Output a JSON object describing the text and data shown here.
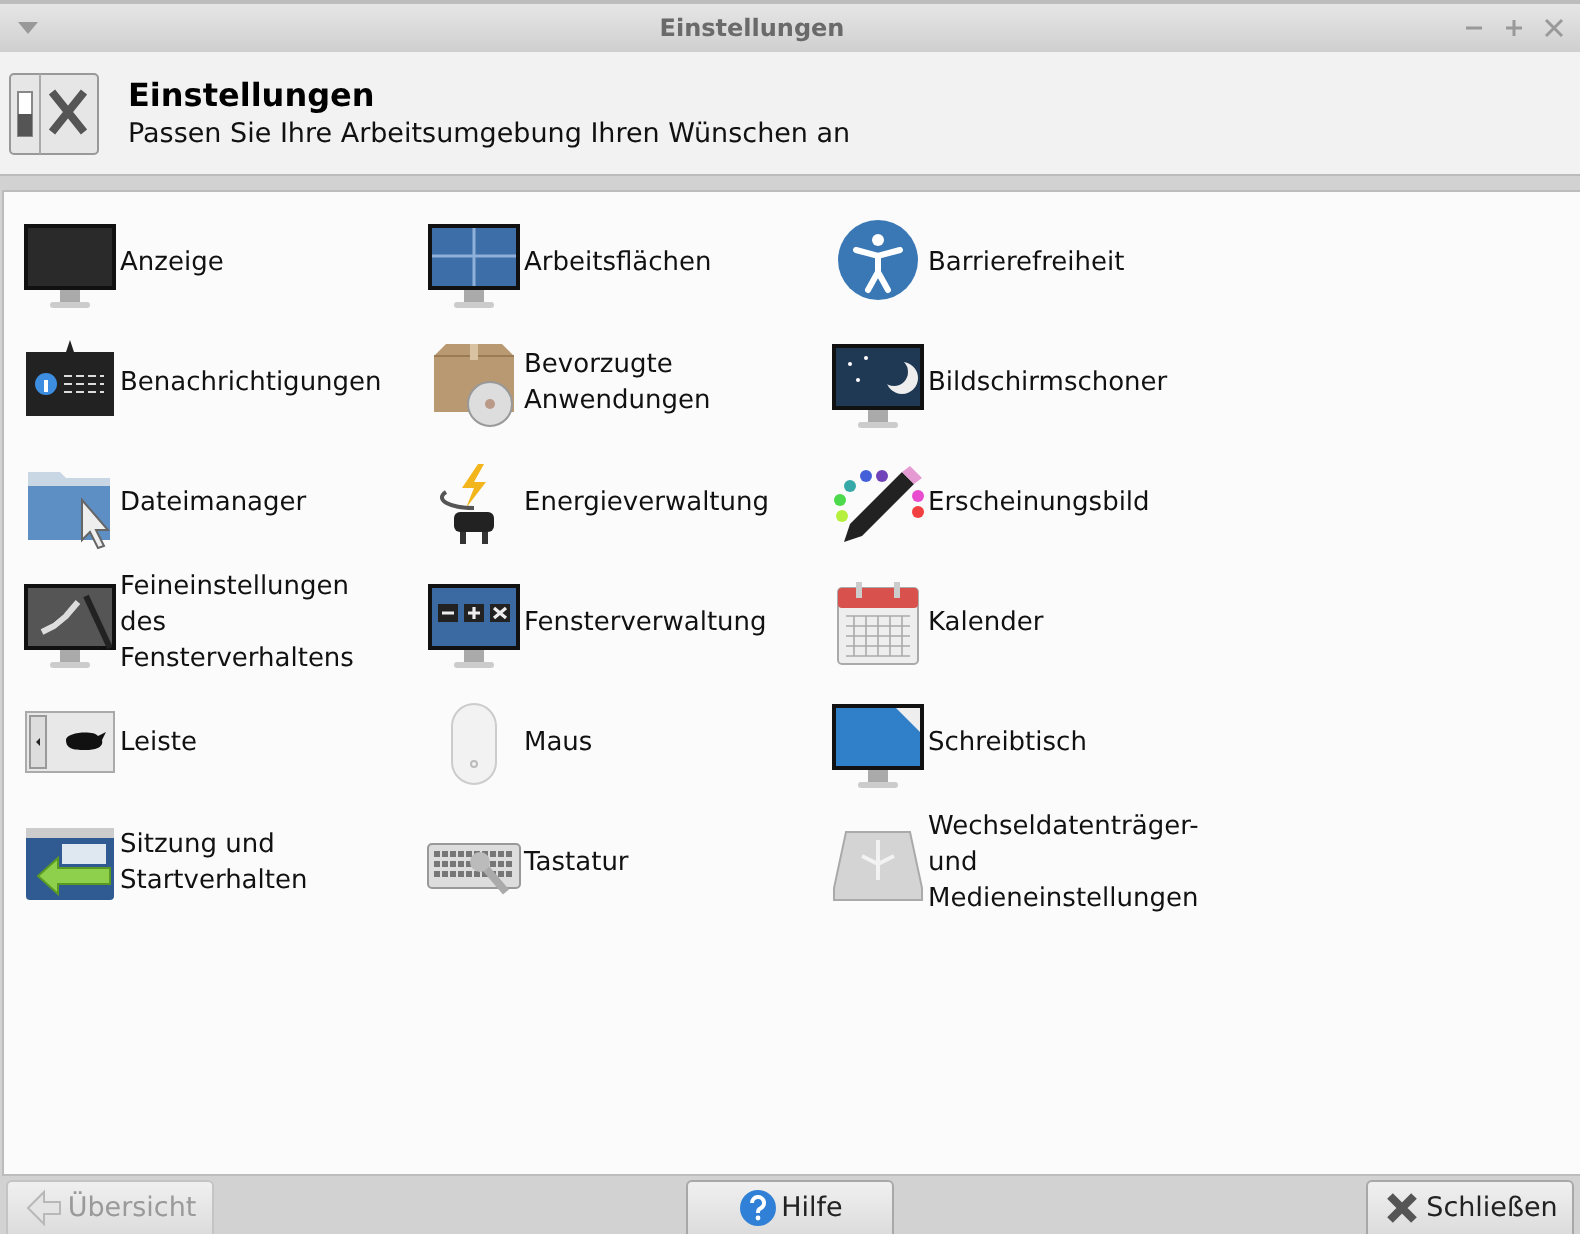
{
  "window": {
    "title": "Einstellungen"
  },
  "header": {
    "title": "Einstellungen",
    "subtitle": "Passen Sie Ihre Arbeitsumgebung Ihren Wünschen an"
  },
  "items": [
    {
      "label": "Anzeige"
    },
    {
      "label": "Arbeitsflächen"
    },
    {
      "label": "Barrierefreiheit"
    },
    {
      "label": "Benachrichtigungen"
    },
    {
      "label": "Bevorzugte Anwendungen"
    },
    {
      "label": "Bildschirmschoner"
    },
    {
      "label": "Dateimanager"
    },
    {
      "label": "Energieverwaltung"
    },
    {
      "label": "Erscheinungsbild"
    },
    {
      "label": "Feineinstellungen des Fensterverhaltens"
    },
    {
      "label": "Fensterverwaltung"
    },
    {
      "label": "Kalender"
    },
    {
      "label": "Leiste"
    },
    {
      "label": "Maus"
    },
    {
      "label": "Schreibtisch"
    },
    {
      "label": "Sitzung und Startverhalten"
    },
    {
      "label": "Tastatur"
    },
    {
      "label": "Wechseldatenträger- und Medieneinstellungen"
    }
  ],
  "buttons": [
    {
      "label": "Übersicht",
      "kind": "back",
      "disabled": true
    },
    {
      "label": "Hilfe",
      "kind": "help",
      "disabled": false
    },
    {
      "label": "Schließen",
      "kind": "close",
      "disabled": false
    }
  ]
}
